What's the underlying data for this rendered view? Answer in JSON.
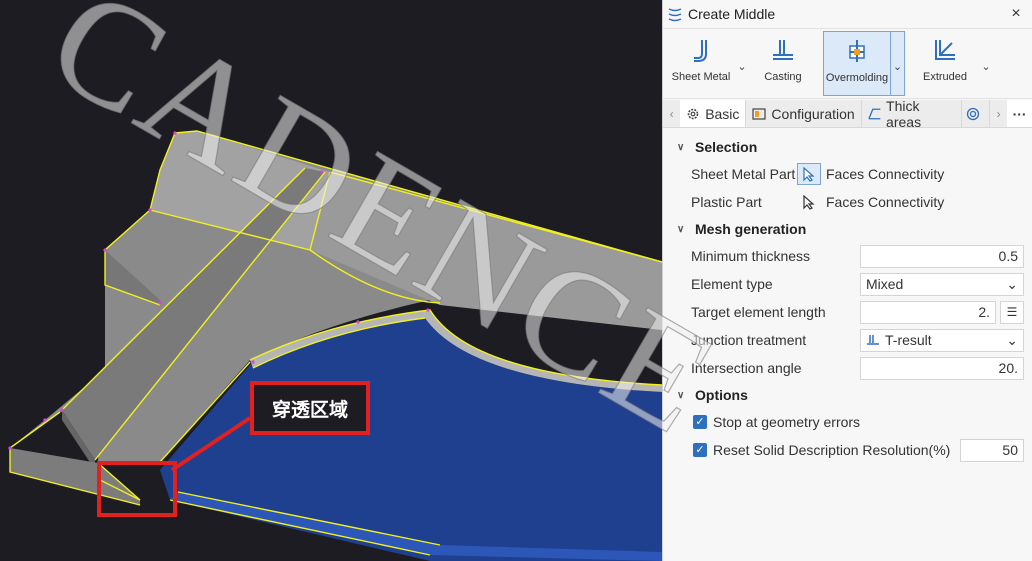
{
  "viewport": {
    "callout_text": "穿透区域"
  },
  "watermark": {
    "text": "CADENCE"
  },
  "panel": {
    "title": "Create Middle",
    "close_icon": "×",
    "tools": [
      {
        "label": "Sheet Metal",
        "icon": "sheet-metal-icon"
      },
      {
        "label": "Casting",
        "icon": "casting-icon"
      },
      {
        "label": "Overmolding",
        "icon": "overmolding-icon",
        "active": true
      },
      {
        "label": "Extruded",
        "icon": "extruded-icon"
      }
    ],
    "tabs": [
      {
        "label": "Basic",
        "icon": "gear-icon",
        "active": true
      },
      {
        "label": "Configuration",
        "icon": "configuration-icon"
      },
      {
        "label": "Thick areas",
        "icon": "thick-areas-icon"
      }
    ],
    "sections": {
      "selection": {
        "title": "Selection",
        "sheet_metal_label": "Sheet Metal Part",
        "sheet_metal_value": "Faces Connectivity",
        "plastic_label": "Plastic Part",
        "plastic_value": "Faces Connectivity"
      },
      "mesh": {
        "title": "Mesh generation",
        "min_thickness_label": "Minimum thickness",
        "min_thickness_value": "0.5",
        "element_type_label": "Element type",
        "element_type_value": "Mixed",
        "target_length_label": "Target element length",
        "target_length_value": "2.",
        "junction_label": "Junction treatment",
        "junction_value": "T-result",
        "intersection_label": "Intersection angle",
        "intersection_value": "20."
      },
      "options": {
        "title": "Options",
        "stop_label": "Stop at geometry errors",
        "stop_checked": true,
        "reset_label": "Reset Solid Description Resolution(%)",
        "reset_checked": true,
        "reset_value": "50"
      }
    }
  },
  "colors": {
    "viewport_bg": "#1c1c22",
    "part_gray": "#8e8e8e",
    "plastic_blue": "#1f3f8f",
    "edge_yellow": "#f0f020",
    "highlight_red": "#e0211f",
    "accent_blue": "#2f6fbf"
  }
}
